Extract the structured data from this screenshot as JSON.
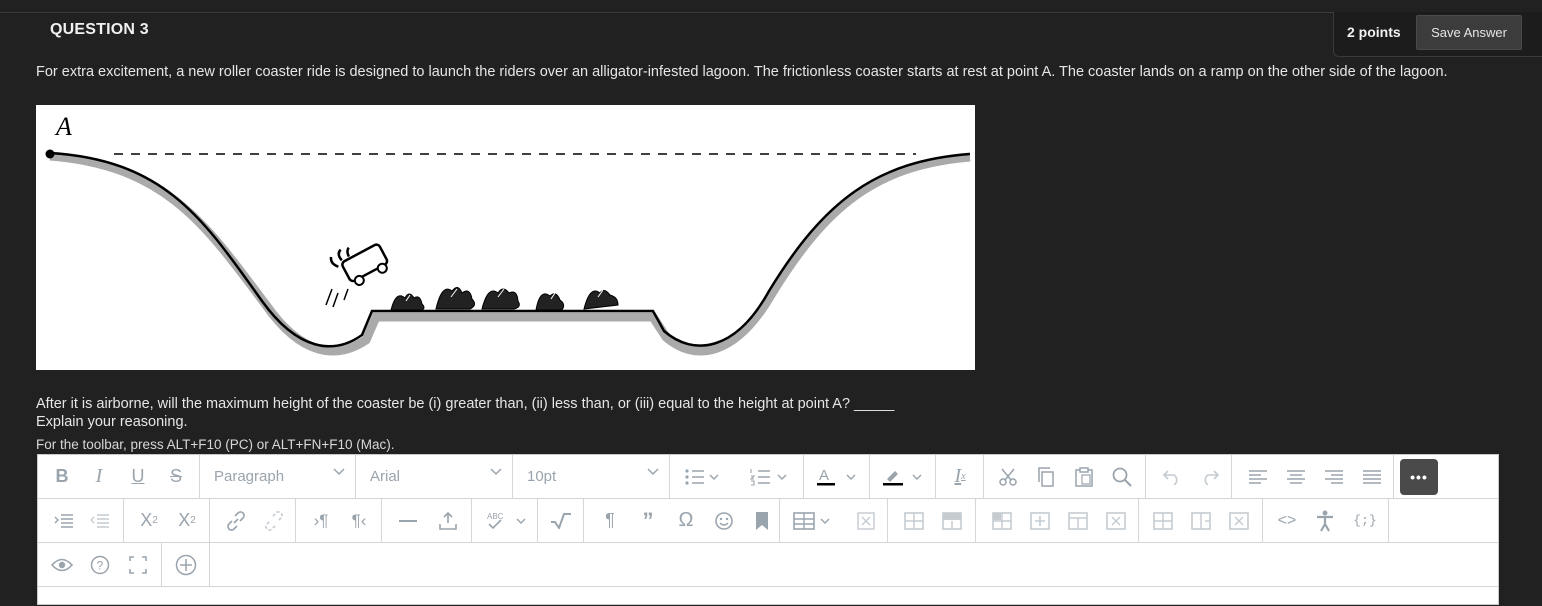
{
  "question": {
    "title": "QUESTION 3",
    "points": "2 points",
    "save_label": "Save Answer",
    "prompt": "For extra excitement, a new roller coaster ride is designed to launch the riders over an alligator-infested lagoon. The frictionless coaster starts at rest at point A. The coaster lands on a ramp on the other side of the lagoon.",
    "figure_label": "A",
    "question_line1": "After it is airborne, will the maximum height of the coaster be (i) greater than, (ii) less than, or (iii) equal to the height at point A? _____",
    "question_line2": "Explain your reasoning.",
    "toolbar_hint": "For the toolbar, press ALT+F10 (PC) or ALT+FN+F10 (Mac)."
  },
  "editor": {
    "block_format": "Paragraph",
    "font_family": "Arial",
    "font_size": "10pt",
    "more_label": "•••",
    "colors": {
      "text_color_bar": "#000000",
      "highlight_bar": "#000000",
      "icon_color": "#9aa4ad"
    }
  }
}
